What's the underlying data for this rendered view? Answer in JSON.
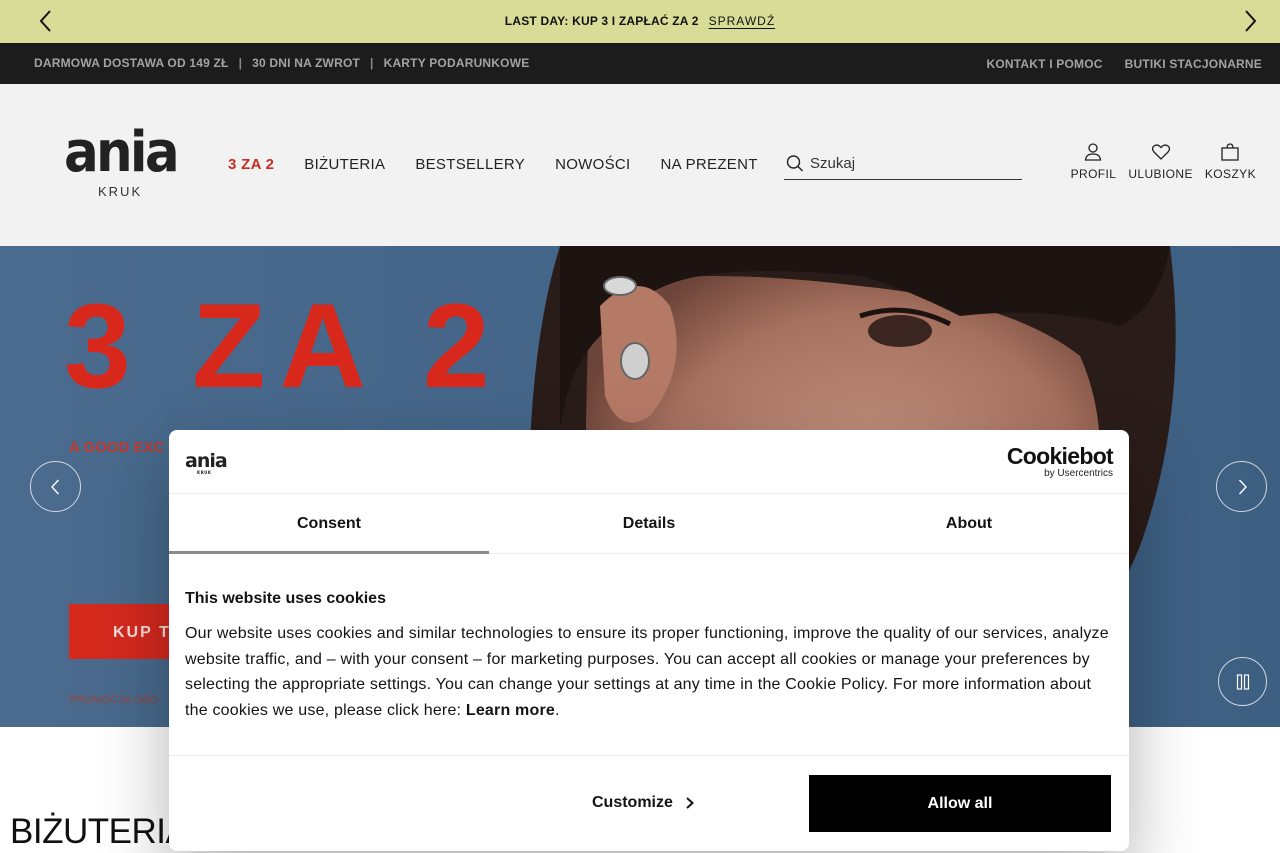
{
  "promo": {
    "message": "LAST DAY: KUP 3 I ZAPŁAĆ ZA 2",
    "cta": "SPRAWDŹ",
    "bg_color": "#d9dc96",
    "prev_icon": "chevron-left-icon",
    "next_icon": "chevron-right-icon"
  },
  "infobar": {
    "left_links": [
      "DARMOWA DOSTAWA OD 149 ZŁ",
      "30 DNI NA ZWROT",
      "KARTY PODARUNKOWE"
    ],
    "separator": "|",
    "right_links": [
      "KONTAKT I POMOC",
      "BUTIKI STACJONARNE"
    ]
  },
  "header": {
    "logo_word": "ania",
    "logo_sub": "KRUK",
    "nav": [
      "3 ZA 2",
      "BIŻUTERIA",
      "BESTSELLERY",
      "NOWOŚCI",
      "NA PREZENT"
    ],
    "nav_highlight_color": "#c92d21",
    "search_placeholder": "Szukaj",
    "actions": [
      {
        "label": "PROFIL",
        "icon": "user-icon"
      },
      {
        "label": "ULUBIONE",
        "icon": "heart-icon"
      },
      {
        "label": "KOSZYK",
        "icon": "bag-icon"
      }
    ]
  },
  "hero": {
    "headline": "3 ZA 2",
    "tagline": "A GOOD EXC",
    "button": "KUP TERAZ",
    "fineprint": "PROMOCJA OBO",
    "accent_color": "#d5291e"
  },
  "section": {
    "title": "BIŻUTERIA"
  },
  "cookie": {
    "logo_word": "ania",
    "logo_sub": "KRUK",
    "brand": "Cookiebot",
    "brand_sub": "by Usercentrics",
    "tabs": [
      "Consent",
      "Details",
      "About"
    ],
    "heading": "This website uses cookies",
    "body": "Our website uses cookies and similar technologies to ensure its proper functioning, improve the quality of our services, analyze website traffic, and – with your consent – for marketing purposes. You can accept all cookies or manage your preferences by selecting the appropriate settings. You can change your settings at any time in the Cookie Policy. For more information about the cookies we use, please click here: ",
    "learn_more": "Learn more",
    "period": ".",
    "customize": "Customize",
    "allow_all": "Allow all"
  }
}
